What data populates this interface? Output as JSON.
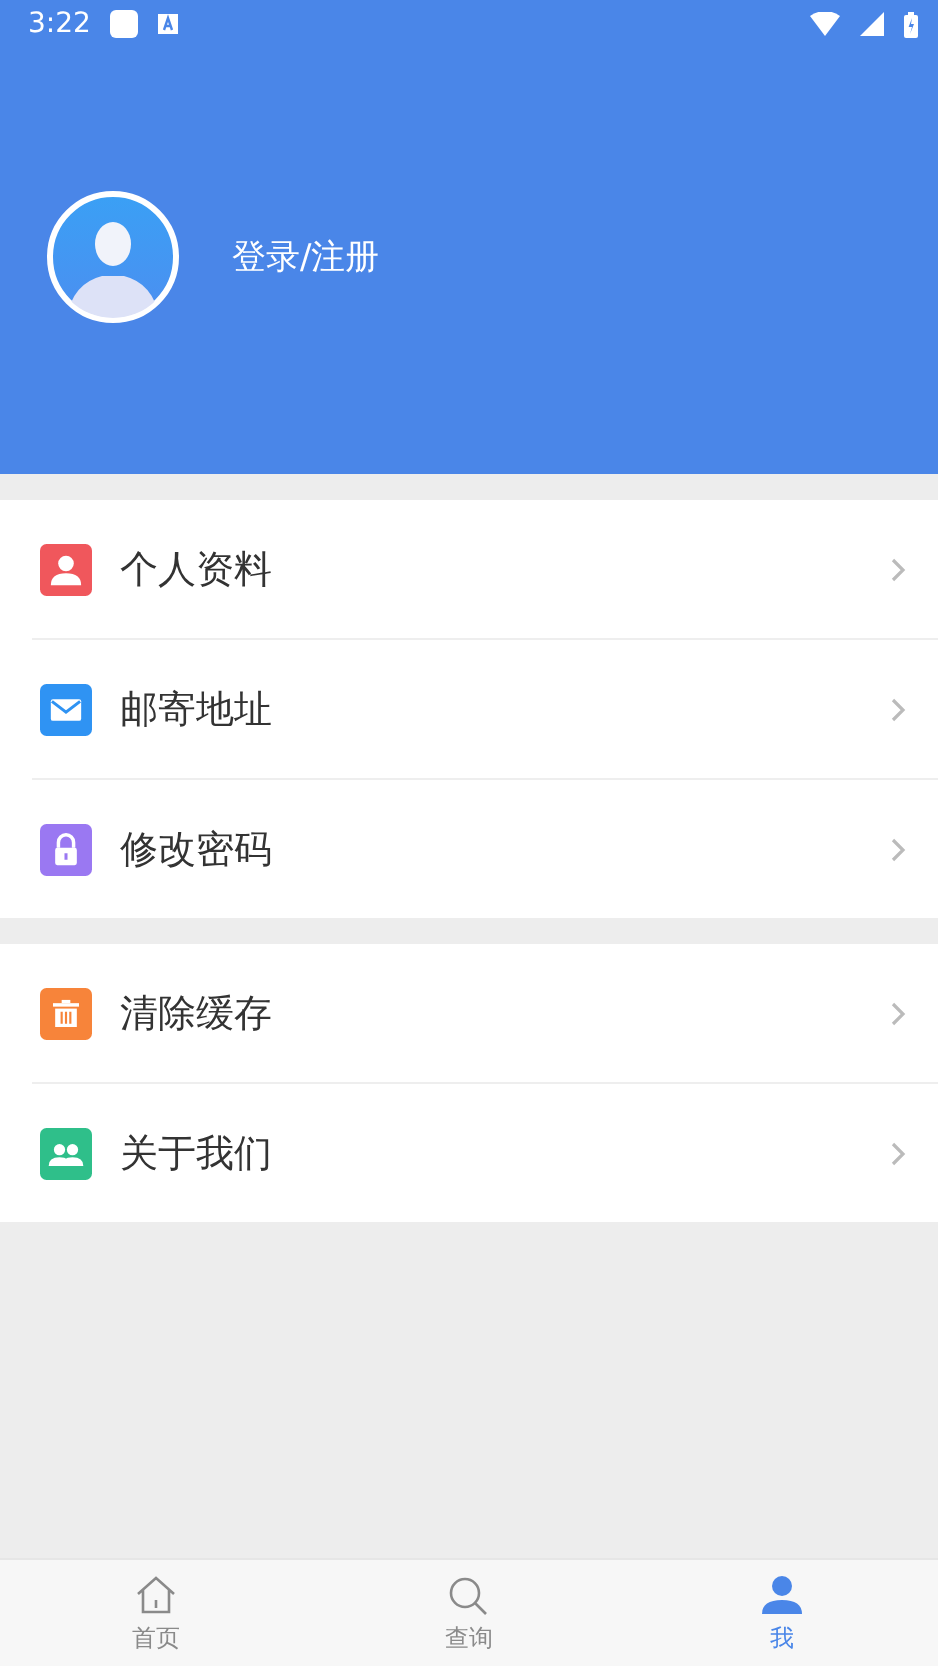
{
  "status_bar": {
    "time": "3:22"
  },
  "profile": {
    "login_label": "登录/注册"
  },
  "menu_groups": [
    {
      "items": [
        {
          "label": "个人资料",
          "kind": "person",
          "color": "#f0575c"
        },
        {
          "label": "邮寄地址",
          "kind": "mail",
          "color": "#2f93f3"
        },
        {
          "label": "修改密码",
          "kind": "lock",
          "color": "#9a78f2"
        }
      ]
    },
    {
      "items": [
        {
          "label": "清除缓存",
          "kind": "trash",
          "color": "#f7843a"
        },
        {
          "label": "关于我们",
          "kind": "group",
          "color": "#2fbf8a"
        }
      ]
    }
  ],
  "tab_bar": [
    {
      "label": "首页",
      "kind": "home",
      "selected": false
    },
    {
      "label": "查询",
      "kind": "search",
      "selected": false
    },
    {
      "label": "我",
      "kind": "person",
      "selected": true
    }
  ]
}
